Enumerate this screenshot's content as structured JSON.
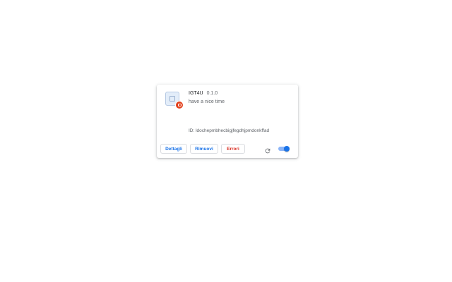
{
  "extension": {
    "name": "IGT4U",
    "version": "0.1.0",
    "description": "have a nice time",
    "id_text": "ID: ldochepmbhecbigjfegdhjpmdonkffad",
    "enabled": true
  },
  "actions": {
    "details_label": "Dettagli",
    "remove_label": "Rimuovi",
    "errors_label": "Errori"
  },
  "icons": {
    "extension": "puzzle-piece-icon",
    "badge": "red-badge-icon",
    "reload": "reload-icon",
    "toggle": "toggle-switch"
  },
  "colors": {
    "accent": "#1a73e8",
    "error": "#d93025",
    "toggle_track": "#8ab4f8"
  }
}
